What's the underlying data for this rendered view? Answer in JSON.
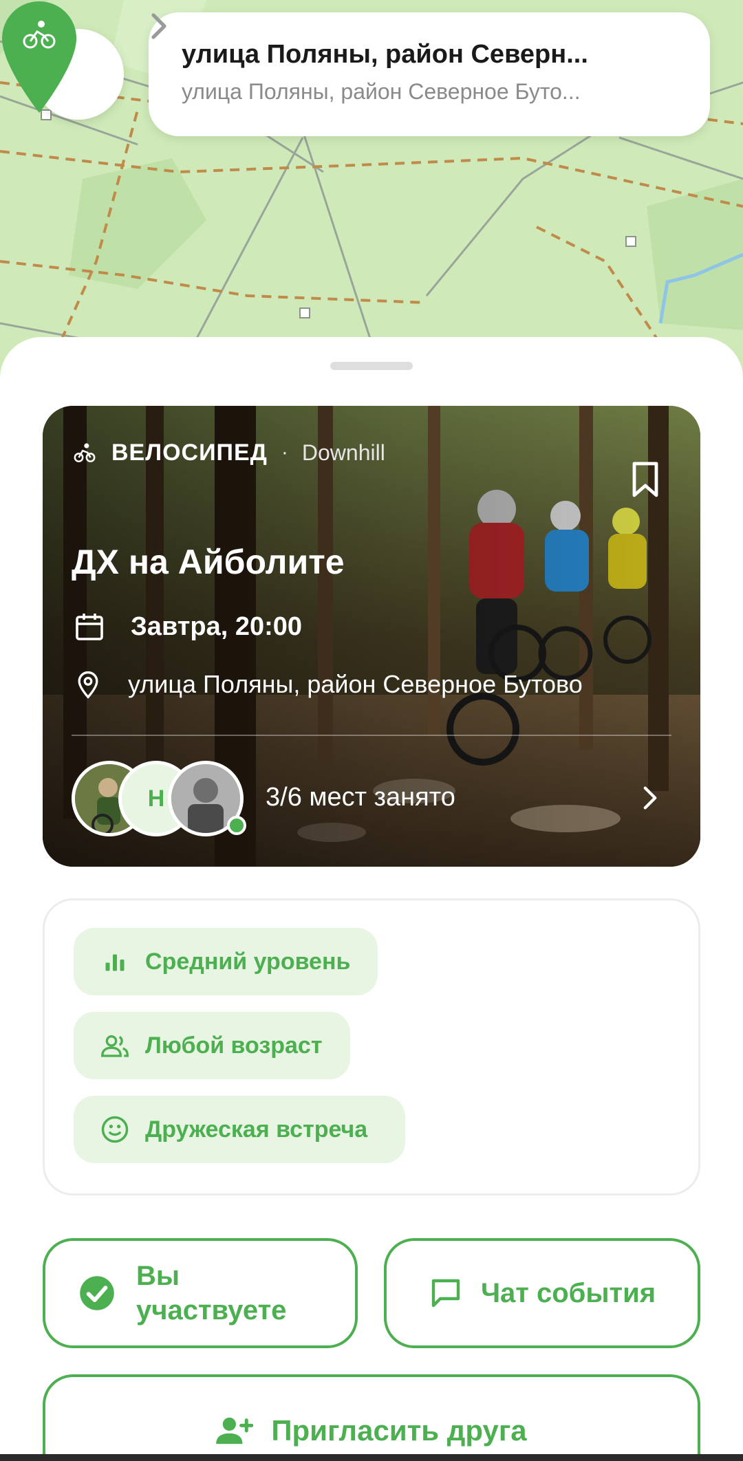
{
  "header": {
    "address_title": "улица Поляны, район Северн...",
    "address_subtitle": "улица Поляны, район Северное Буто..."
  },
  "icons": {
    "back": "arrow-left-icon",
    "address_chevron": "chevron-right-icon",
    "map_pin": "bike-pin-icon",
    "category": "bike-icon",
    "bookmark": "bookmark-icon",
    "calendar": "calendar-icon",
    "location": "location-pin-icon",
    "level": "bar-chart-icon",
    "age": "people-icon",
    "mood": "smile-icon",
    "joined": "check-circle-icon",
    "chat": "chat-bubble-icon",
    "invite": "add-person-icon"
  },
  "event": {
    "category": "ВЕЛОСИПЕД",
    "separator": "·",
    "subcategory": "Downhill",
    "title": "ДХ на Айболите",
    "datetime": "Завтра, 20:00",
    "place": "улица Поляны, район Северное Бутово",
    "participant_initial": "Н",
    "seats": "3/6 мест занято"
  },
  "tags": [
    {
      "label": "Средний уровень"
    },
    {
      "label": "Любой возраст"
    },
    {
      "label": "Дружеская встреча"
    }
  ],
  "actions": {
    "joined": "Вы участвуете",
    "chat": "Чат события",
    "invite": "Пригласить друга"
  },
  "colors": {
    "accent": "#4caf50",
    "tag_bg": "#e7f5e2",
    "map_bg": "#cfeab8"
  }
}
